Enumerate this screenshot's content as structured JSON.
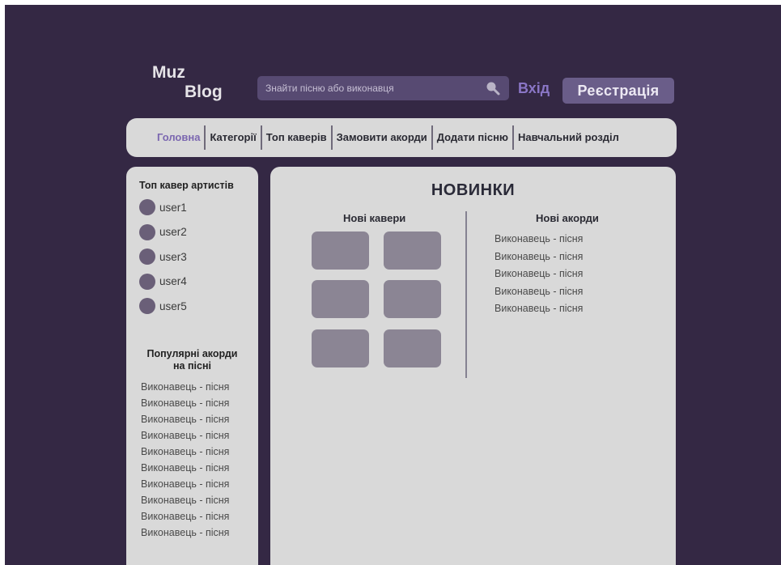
{
  "logo": {
    "line1": "Muz",
    "line2": "Blog"
  },
  "search": {
    "placeholder": "Знайти пісню або виконавця",
    "icon": "search-icon"
  },
  "header": {
    "login_label": "Вхід",
    "register_label": "Реєстрація"
  },
  "nav": {
    "items": [
      {
        "label": "Головна",
        "active": true
      },
      {
        "label": "Категорії"
      },
      {
        "label": "Топ каверів"
      },
      {
        "label": "Замовити акорди"
      },
      {
        "label": "Додати пісню"
      },
      {
        "label": "Навчальний розділ"
      }
    ]
  },
  "sidebar": {
    "top_title": "Топ кавер артистів",
    "users": [
      "user1",
      "user2",
      "user3",
      "user4",
      "user5"
    ],
    "popular_title_line1": "Популярні акорди",
    "popular_title_line2": "на пісні",
    "popular": [
      "Виконавець - пісня",
      "Виконавець - пісня",
      "Виконавець - пісня",
      "Виконавець - пісня",
      "Виконавець - пісня",
      "Виконавець - пісня",
      "Виконавець - пісня",
      "Виконавець - пісня",
      "Виконавець - пісня",
      "Виконавець - пісня"
    ]
  },
  "main": {
    "title": "НОВИНКИ",
    "covers_title": "Нові кавери",
    "chords_title": "Нові акорди",
    "chords": [
      "Виконавець - пісня",
      "Виконавець - пісня",
      "Виконавець - пісня",
      "Виконавець - пісня",
      "Виконавець - пісня"
    ]
  },
  "colors": {
    "background": "#342844",
    "panel": "#d9d9d9",
    "accent": "#8a76c6",
    "search_bg": "#574a72",
    "register_bg": "#6a5d89",
    "cover_placeholder": "#8b8594"
  }
}
